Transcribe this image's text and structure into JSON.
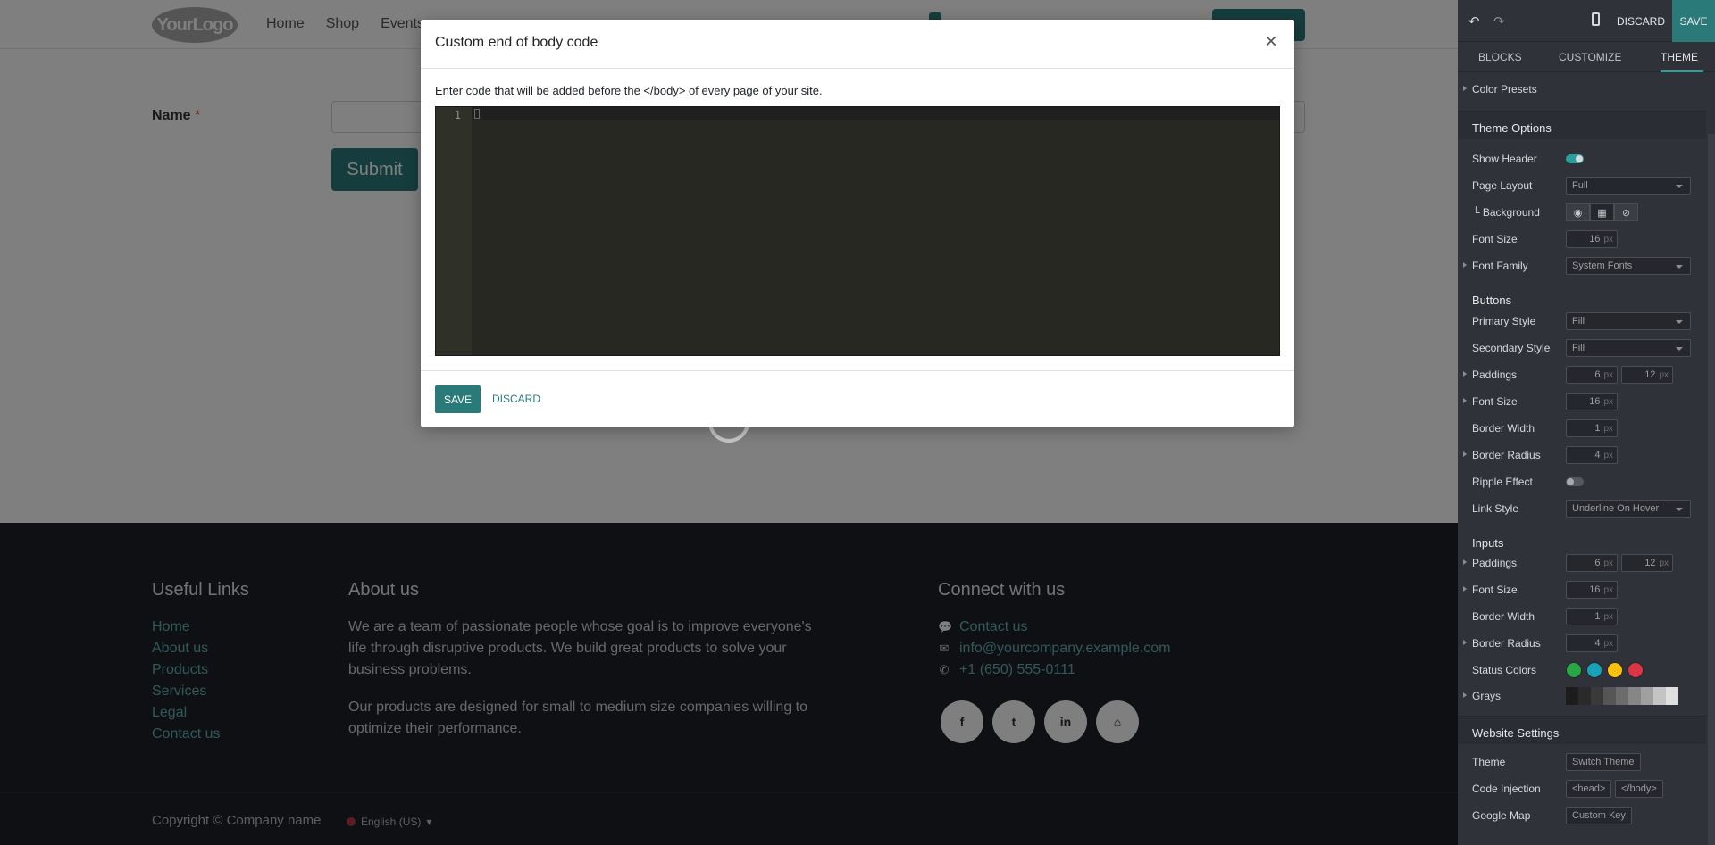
{
  "site": {
    "logo": "YourLogo",
    "nav": [
      "Home",
      "Shop",
      "Events"
    ],
    "form": {
      "name_label": "Name",
      "required_mark": "*",
      "submit_label": "Submit"
    }
  },
  "footer": {
    "useful_links_title": "Useful Links",
    "useful_links": [
      "Home",
      "About us",
      "Products",
      "Services",
      "Legal",
      "Contact us"
    ],
    "about_title": "About us",
    "about_p1": "We are a team of passionate people whose goal is to improve everyone's life through disruptive products. We build great products to solve your business problems.",
    "about_p2": "Our products are designed for small to medium size companies willing to optimize their performance.",
    "connect_title": "Connect with us",
    "contact": [
      {
        "icon": "comment-icon",
        "glyph": "💬",
        "text": "Contact us"
      },
      {
        "icon": "envelope-icon",
        "glyph": "✉",
        "text": "info@yourcompany.example.com"
      },
      {
        "icon": "phone-icon",
        "glyph": "✆",
        "text": "+1 (650) 555-0111"
      }
    ],
    "social": [
      {
        "icon": "facebook-icon",
        "glyph": "f"
      },
      {
        "icon": "twitter-icon",
        "glyph": "t"
      },
      {
        "icon": "linkedin-icon",
        "glyph": "in"
      },
      {
        "icon": "home-icon",
        "glyph": "⌂"
      }
    ],
    "copyright": "Copyright © Company name",
    "language": "English (US)"
  },
  "modal": {
    "title": "Custom end of body code",
    "close_glyph": "×",
    "description": "Enter code that will be added before the </body> of every page of your site.",
    "line_number": "1",
    "save_label": "SAVE",
    "discard_label": "DISCARD"
  },
  "panel": {
    "discard_label": "DISCARD",
    "save_label": "SAVE",
    "undo_glyph": "↶",
    "redo_glyph": "↷",
    "tabs": [
      "BLOCKS",
      "CUSTOMIZE",
      "THEME"
    ],
    "color_presets": "Color Presets",
    "theme_options_title": "Theme Options",
    "show_header": "Show Header",
    "page_layout": "Page Layout",
    "page_layout_value": "Full",
    "background": "└ Background",
    "font_size": "Font Size",
    "font_size_value": "16",
    "font_family": "Font Family",
    "font_family_value": "System Fonts",
    "buttons_title": "Buttons",
    "primary_style": "Primary Style",
    "primary_style_value": "Fill",
    "secondary_style": "Secondary Style",
    "secondary_style_value": "Fill",
    "paddings": "Paddings",
    "btn_padding_y": "6",
    "btn_padding_x": "12",
    "btn_font_size_value": "16",
    "border_width": "Border Width",
    "btn_border_width_value": "1",
    "border_radius": "Border Radius",
    "btn_border_radius_value": "4",
    "ripple_effect": "Ripple Effect",
    "link_style": "Link Style",
    "link_style_value": "Underline On Hover",
    "inputs_title": "Inputs",
    "inp_padding_y": "6",
    "inp_padding_x": "12",
    "inp_font_size_value": "16",
    "inp_border_width_value": "1",
    "inp_border_radius_value": "4",
    "status_colors": "Status Colors",
    "status_color_values": [
      "#28a745",
      "#17a2b8",
      "#ffc107",
      "#dc3545"
    ],
    "grays": "Grays",
    "website_settings_title": "Website Settings",
    "theme": "Theme",
    "switch_theme": "Switch Theme",
    "code_injection": "Code Injection",
    "head_btn": "<head>",
    "body_btn": "</body>",
    "google_map": "Google Map",
    "custom_key": "Custom Key",
    "unit": "px"
  },
  "colors": {
    "accent": "#2b7a7a",
    "panel_bg": "#2f3238",
    "footer_bg": "#1f2029",
    "editor_bg": "#272822"
  }
}
